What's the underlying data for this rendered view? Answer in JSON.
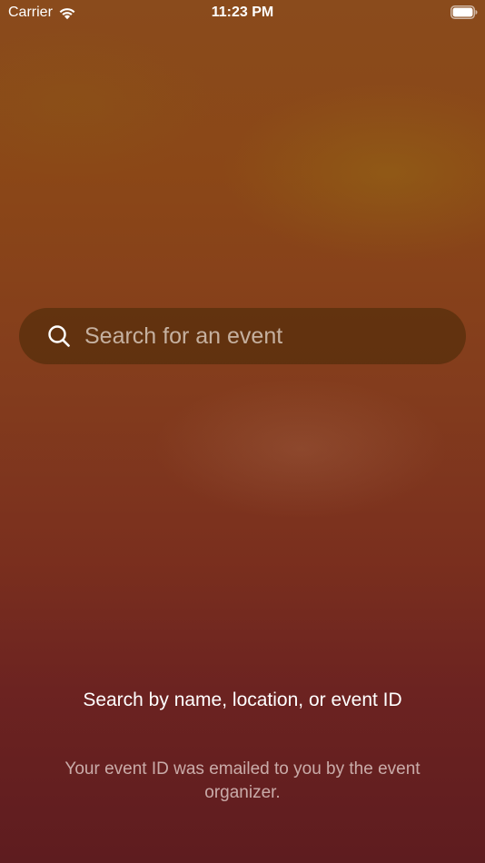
{
  "status_bar": {
    "carrier": "Carrier",
    "time": "11:23 PM",
    "wifi_icon": "wifi-icon",
    "battery_icon": "battery-icon"
  },
  "search": {
    "placeholder": "Search for an event",
    "value": "",
    "icon": "search-icon"
  },
  "hint": {
    "title": "Search by name, location, or event ID",
    "subtitle": "Your event ID was emailed to you by the event organizer."
  },
  "colors": {
    "background_top": "#8a4b1c",
    "background_bottom": "#5e1c1f",
    "search_bar": "#462805",
    "text": "#ffffff"
  }
}
